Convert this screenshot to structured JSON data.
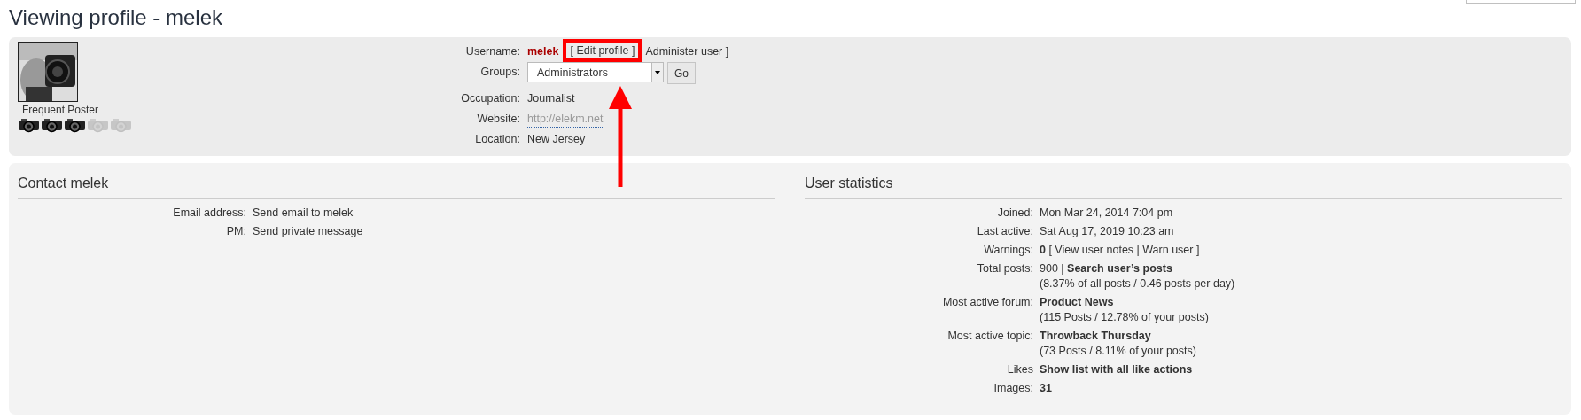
{
  "page": {
    "title": "Viewing profile - melek"
  },
  "profile": {
    "rank_title": "Frequent Poster",
    "rank_icons": [
      {
        "on": true
      },
      {
        "on": true
      },
      {
        "on": true
      },
      {
        "on": false
      },
      {
        "on": false
      }
    ],
    "fields": [
      {
        "kind": "username",
        "label": "Username:",
        "value": "melek",
        "links": [
          {
            "text": "[ Edit profile ]",
            "highlighted": true
          },
          {
            "text": "Administer user ]",
            "highlighted": false
          }
        ]
      },
      {
        "kind": "select",
        "label": "Groups:",
        "value": "Administrators",
        "button": "Go"
      },
      {
        "kind": "text",
        "label": "Occupation:",
        "value": "Journalist"
      },
      {
        "kind": "link",
        "label": "Website:",
        "value": "http://elekm.net"
      },
      {
        "kind": "text",
        "label": "Location:",
        "value": "New Jersey"
      }
    ]
  },
  "contact": {
    "title": "Contact melek",
    "rows": [
      {
        "label": "Email address:",
        "value": "Send email to melek",
        "emphasis": false
      },
      {
        "label": "PM:",
        "value": "Send private message",
        "emphasis": false
      }
    ]
  },
  "stats": {
    "title": "User statistics",
    "rows": [
      {
        "label": "Joined:",
        "value": "Mon Mar 24, 2014 7:04 pm",
        "emphasis": false
      },
      {
        "label": "Last active:",
        "value": "Sat Aug 17, 2019 10:23 am",
        "emphasis": false
      },
      {
        "label": "Warnings:",
        "value": "**0** [ View user notes | Warn user ]",
        "emphasis": false
      },
      {
        "label": "Total posts:",
        "value": "900 | **Search user’s posts**",
        "note": "(8.37% of all posts / 0.46 posts per day)",
        "emphasis": false
      },
      {
        "label": "Most active forum:",
        "value": "Product News",
        "note": "(115 Posts / 12.78% of your posts)",
        "emphasis": true
      },
      {
        "label": "Most active topic:",
        "value": "Throwback Thursday",
        "note": "(73 Posts / 8.11% of your posts)",
        "emphasis": true
      },
      {
        "label": "Likes",
        "value": "Show list with all like actions",
        "emphasis": true
      },
      {
        "label": "Images:",
        "value": "31",
        "emphasis": true
      }
    ]
  }
}
